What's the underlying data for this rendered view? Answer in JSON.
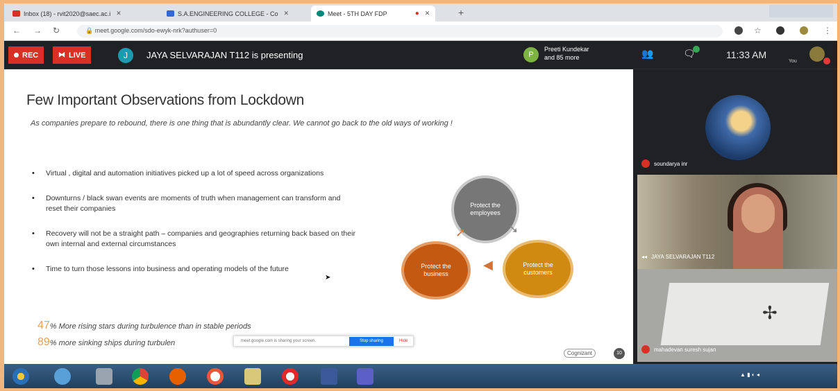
{
  "browser": {
    "tabs": [
      {
        "label": "Inbox (18) - rvit2020@saec.ac.i"
      },
      {
        "label": "S.A.ENGINEERING COLLEGE - Co"
      },
      {
        "label": "Meet - 5TH DAY FDP"
      }
    ],
    "url": "meet.google.com/sdo-ewyk-nrk?authuser=0"
  },
  "meet": {
    "rec_label": "REC",
    "live_label": "LIVE",
    "presenter_initial": "J",
    "presenting_text": "JAYA SELVARAJAN T112 is presenting",
    "participant_initial": "P",
    "participants_line1": "Preeti Kundekar",
    "participants_line2": "and 85 more",
    "time": "11:33 AM",
    "you_label": "You"
  },
  "slide": {
    "title": "Few Important Observations from Lockdown",
    "intro": "As companies prepare to rebound, there is one thing that is abundantly clear. We cannot go back to the old ways of working !",
    "bullets": [
      "Virtual , digital and automation initiatives picked up a lot of speed across organizations",
      "Downturns / black swan events are moments of truth when management can transform and reset their companies",
      "Recovery will not be a straight path – companies and geographies returning back based on their own internal and external circumstances",
      "Time to turn those lessons into business and operating models of the future"
    ],
    "stat1_num": "47",
    "stat1_text": "% More rising stars during turbulence than in stable periods",
    "stat2_num": "89",
    "stat2_text": "% more sinking ships during turbulen",
    "cycle": {
      "employees": "Protect the employees",
      "customers": "Protect the customers",
      "business": "Protect the business"
    },
    "logo": "Cognizant",
    "page_number": "10",
    "notification_text": "meet.google.com is sharing your screen.",
    "notification_stop": "Stop sharing",
    "notification_hide": "Hide"
  },
  "tiles": [
    {
      "name": "soundarya inr"
    },
    {
      "name": "JAYA SELVARAJAN T112"
    },
    {
      "name": "mahadevan suresh sujan"
    }
  ],
  "colors": {
    "rec": "#d93025",
    "page_border": "#f2b57c",
    "stat_accent": "#e8a25a"
  }
}
